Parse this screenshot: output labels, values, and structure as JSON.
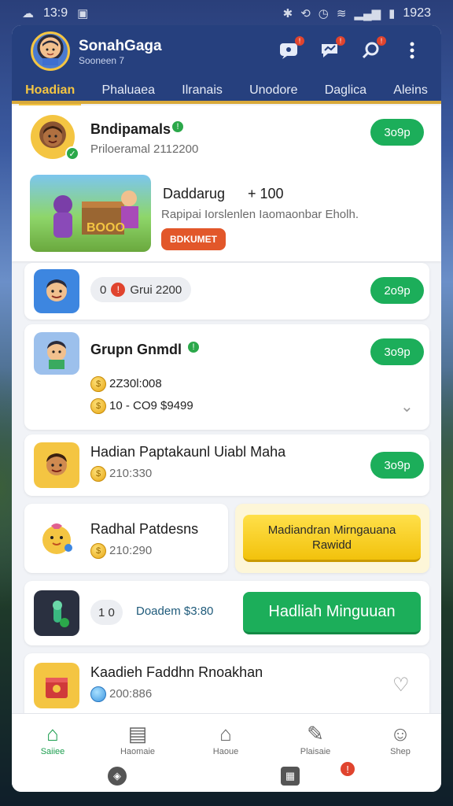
{
  "status_bar": {
    "time_left": "13:9",
    "time_right": "1923"
  },
  "header": {
    "user_name": "SonahGaga",
    "user_sub": "Sooneen 7",
    "tabs": [
      {
        "label": "Hoadian",
        "active": true
      },
      {
        "label": "Phaluaea",
        "active": false
      },
      {
        "label": "Ilranais",
        "active": false
      },
      {
        "label": "Unodore",
        "active": false
      },
      {
        "label": "Daglica",
        "active": false
      },
      {
        "label": "Aleins",
        "active": false
      }
    ],
    "icons": [
      "message-icon",
      "chat-icon",
      "search-icon",
      "more-icon"
    ]
  },
  "cards": {
    "c1": {
      "title": "Bndipamals",
      "subtitle": "Priloeramal 2112200",
      "button": "3o9p"
    },
    "c2": {
      "title": "Daddarug",
      "amount": "+ 100",
      "desc": "Rapipai Iorslenlen Iaomaonbar Eholh.",
      "button": "BDKUMET"
    },
    "c3": {
      "pill_num": "0",
      "pill_text": "Grui 2200",
      "button": "2o9p"
    },
    "c4": {
      "title": "Grupn Gnmdl",
      "line1": "2Z30l:008",
      "line2": "10 - CO9 $9499",
      "button": "3o9p"
    },
    "c5": {
      "title": "Hadian Paptakaunl Uiabl Maha",
      "value": "210:330",
      "button": "3o9p"
    },
    "c6": {
      "title": "Radhal Patdesns",
      "value": "210:290"
    },
    "c6b": {
      "button": "Madiandran Mirngauana Rawidd"
    },
    "c7": {
      "badge": "1 0",
      "text": "Doadem $3:80",
      "button": "Hadliah Minguuan"
    },
    "c8": {
      "title": "Kaadieh Faddhn Rnoakhan",
      "value": "200:886"
    }
  },
  "bottom_nav": [
    {
      "label": "Saiiee",
      "icon": "home-icon",
      "active": true
    },
    {
      "label": "Haomaie",
      "icon": "clipboard-icon",
      "active": false
    },
    {
      "label": "Haoue",
      "icon": "house-icon",
      "active": false
    },
    {
      "label": "Plaisaie",
      "icon": "edit-icon",
      "active": false
    },
    {
      "label": "Shep",
      "icon": "profile-icon",
      "active": false
    }
  ],
  "colors": {
    "header_bg": "#26407e",
    "accent_gold": "#f4c542",
    "green": "#1cae5a",
    "yellow_btn": "#f5d02c"
  }
}
